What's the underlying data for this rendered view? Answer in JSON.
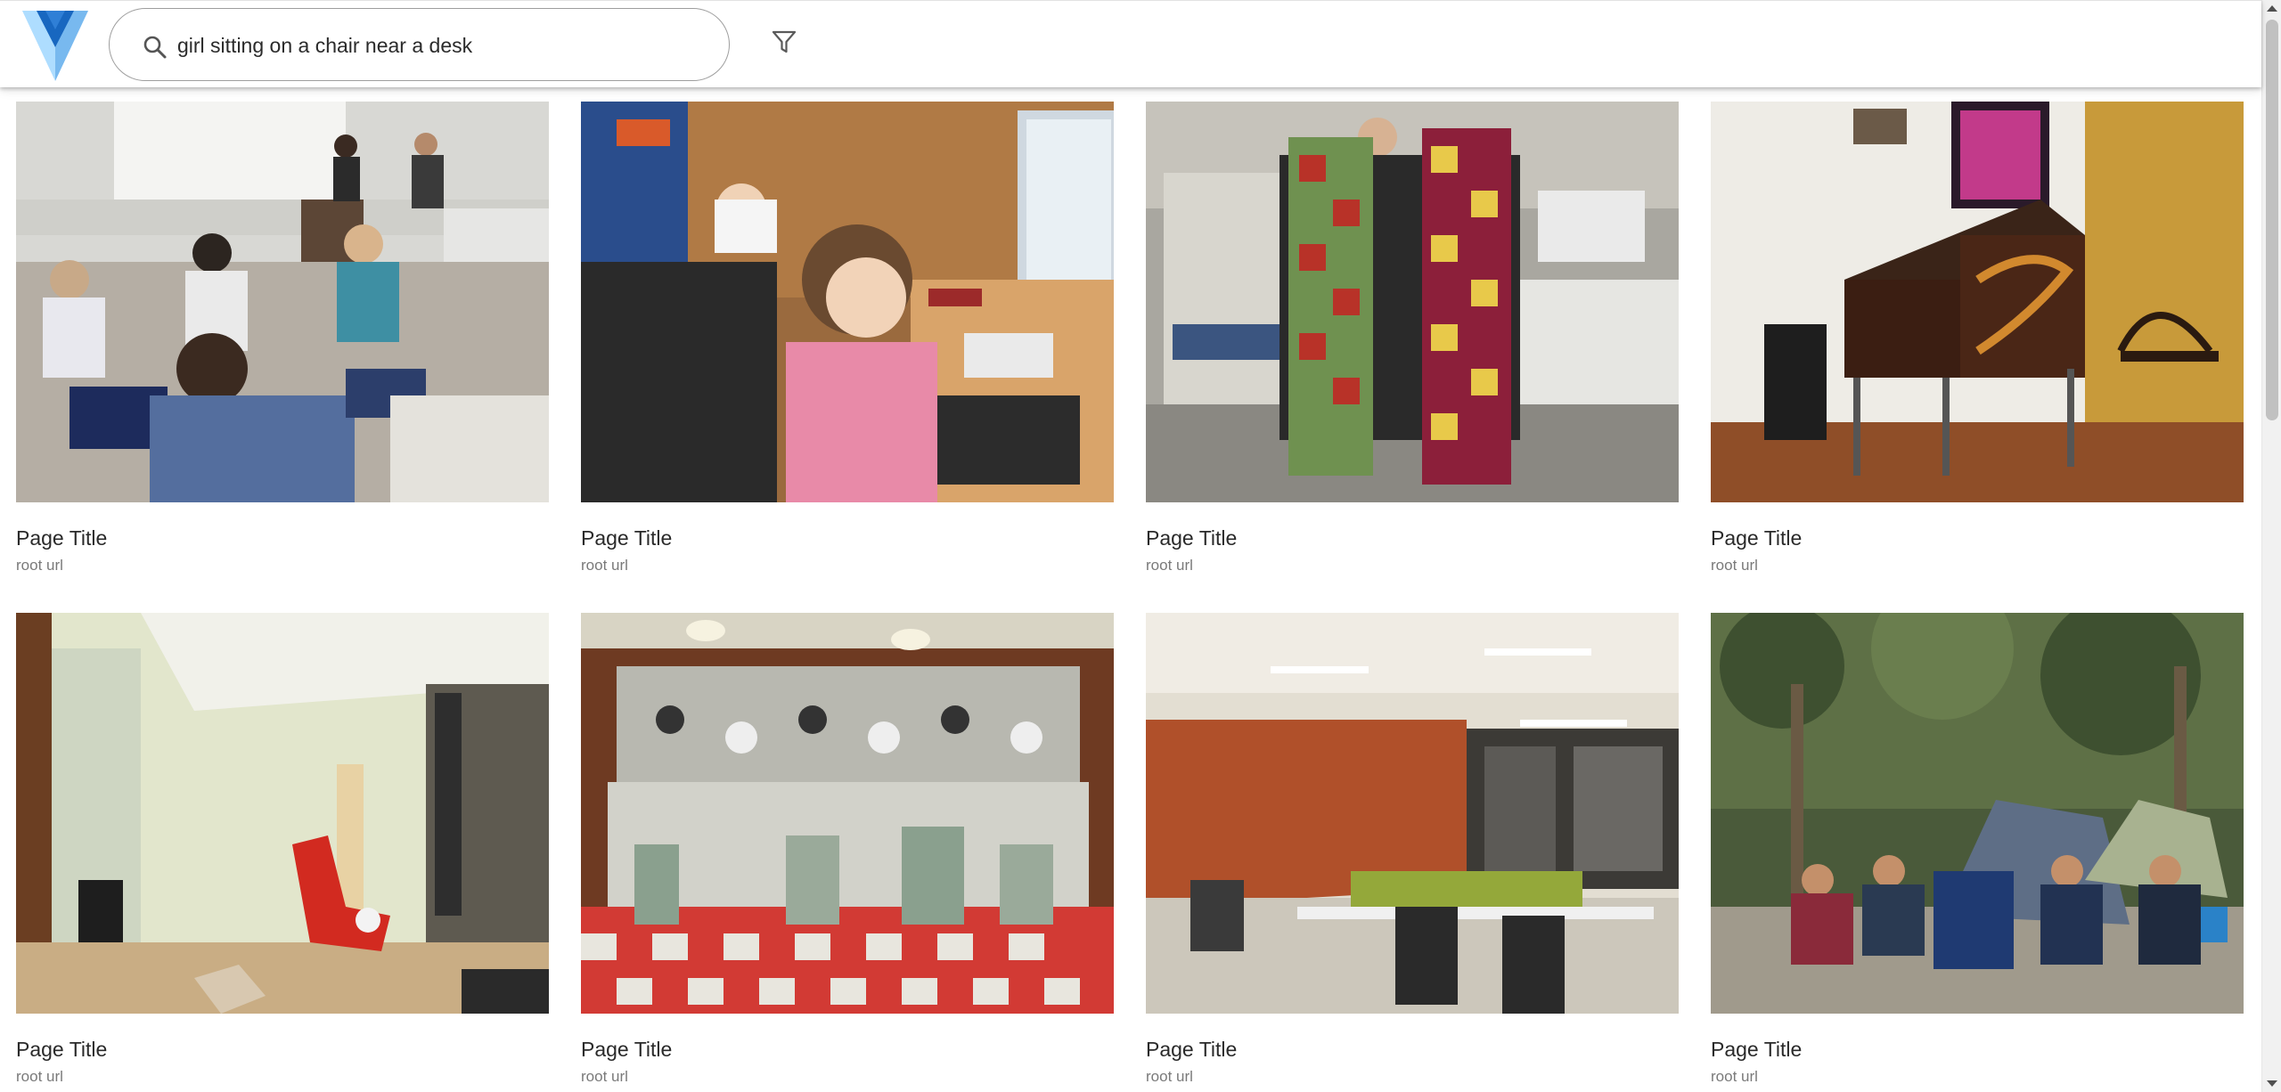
{
  "header": {
    "logo_icon": "vuetify-logo-icon",
    "search": {
      "value": "girl sitting on a chair near a desk",
      "placeholder": "",
      "icon": "search-icon"
    },
    "filter_icon": "filter-icon"
  },
  "results": [
    {
      "title": "Page Title",
      "url": "root url"
    },
    {
      "title": "Page Title",
      "url": "root url"
    },
    {
      "title": "Page Title",
      "url": "root url"
    },
    {
      "title": "Page Title",
      "url": "root url"
    },
    {
      "title": "Page Title",
      "url": "root url"
    },
    {
      "title": "Page Title",
      "url": "root url"
    },
    {
      "title": "Page Title",
      "url": "root url"
    },
    {
      "title": "Page Title",
      "url": "root url"
    }
  ],
  "colors": {
    "logo_dark": "#1867c0",
    "logo_light": "#aeddff",
    "title_text": "#2a2a2a",
    "url_text": "#7a7a7a"
  }
}
